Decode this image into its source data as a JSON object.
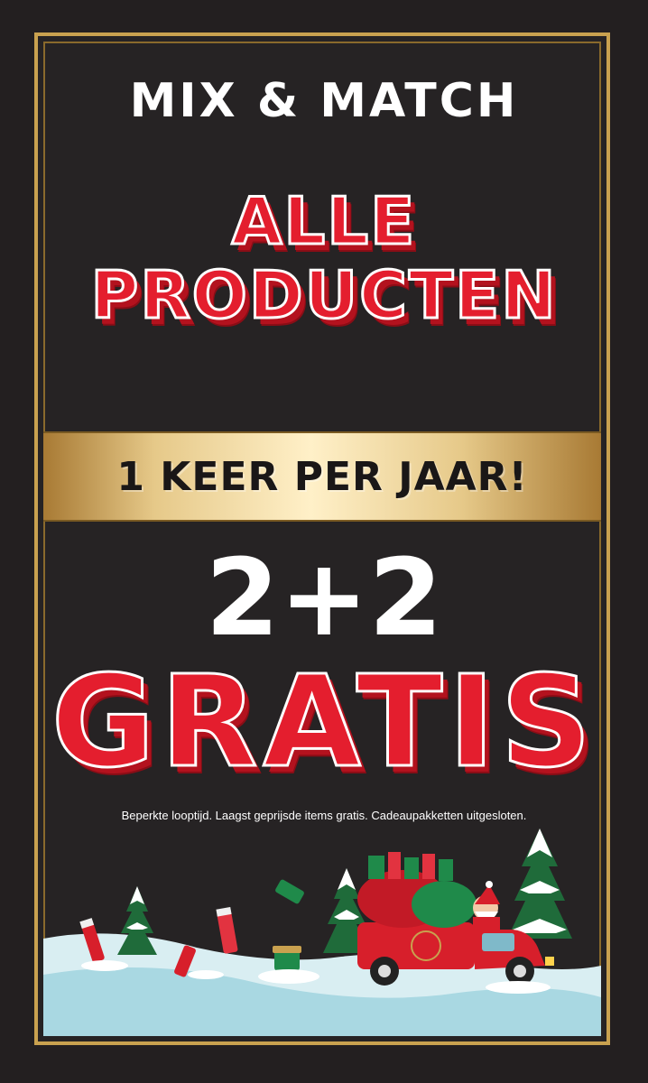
{
  "promo": {
    "kicker": "MIX & MATCH",
    "headline_line1": "ALLE",
    "headline_line2": "PRODUCTEN",
    "banner": "1 KEER PER JAAR!",
    "offer_numbers": "2+2",
    "offer_word": "GRATIS",
    "disclaimer": "Beperkte looptijd. Laagst geprijsde items gratis. Cadeaupakketten uitgesloten."
  },
  "colors": {
    "background": "#231f20",
    "gold": "#c9a14f",
    "red": "#e41e2e",
    "snow": "#d9eef2",
    "tree": "#1f6b3a"
  },
  "illustration": {
    "icons": [
      "christmas-tree-icon",
      "delivery-truck-icon",
      "santa-icon",
      "gift-bag-icon",
      "product-tube-icon"
    ]
  }
}
